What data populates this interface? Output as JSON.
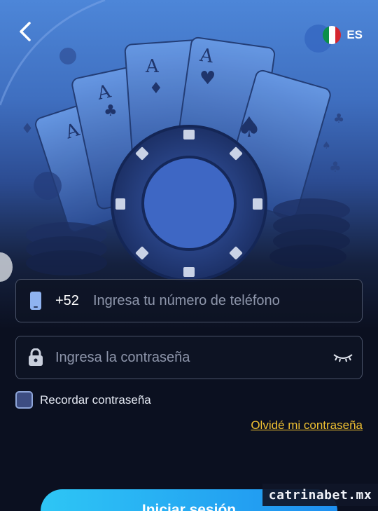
{
  "header": {
    "language_code": "ES"
  },
  "form": {
    "phone_prefix": "+52",
    "phone_placeholder": "Ingresa tu número de teléfono",
    "password_placeholder": "Ingresa la contraseña",
    "remember_label": "Recordar contraseña",
    "remember_checked": false,
    "forgot_link": "Olvidé mi contraseña",
    "login_button": "Iniciar sesión"
  },
  "watermark": "catrinabet.mx",
  "colors": {
    "accent_link": "#f1c232",
    "button_start": "#2ec6f5",
    "button_end": "#1e8ff0",
    "background": "#0b1020"
  },
  "icons": {
    "back": "chevron-left-icon",
    "flag": "mexico-flag-icon",
    "phone": "phone-icon",
    "lock": "lock-icon",
    "eye": "eye-closed-icon"
  }
}
